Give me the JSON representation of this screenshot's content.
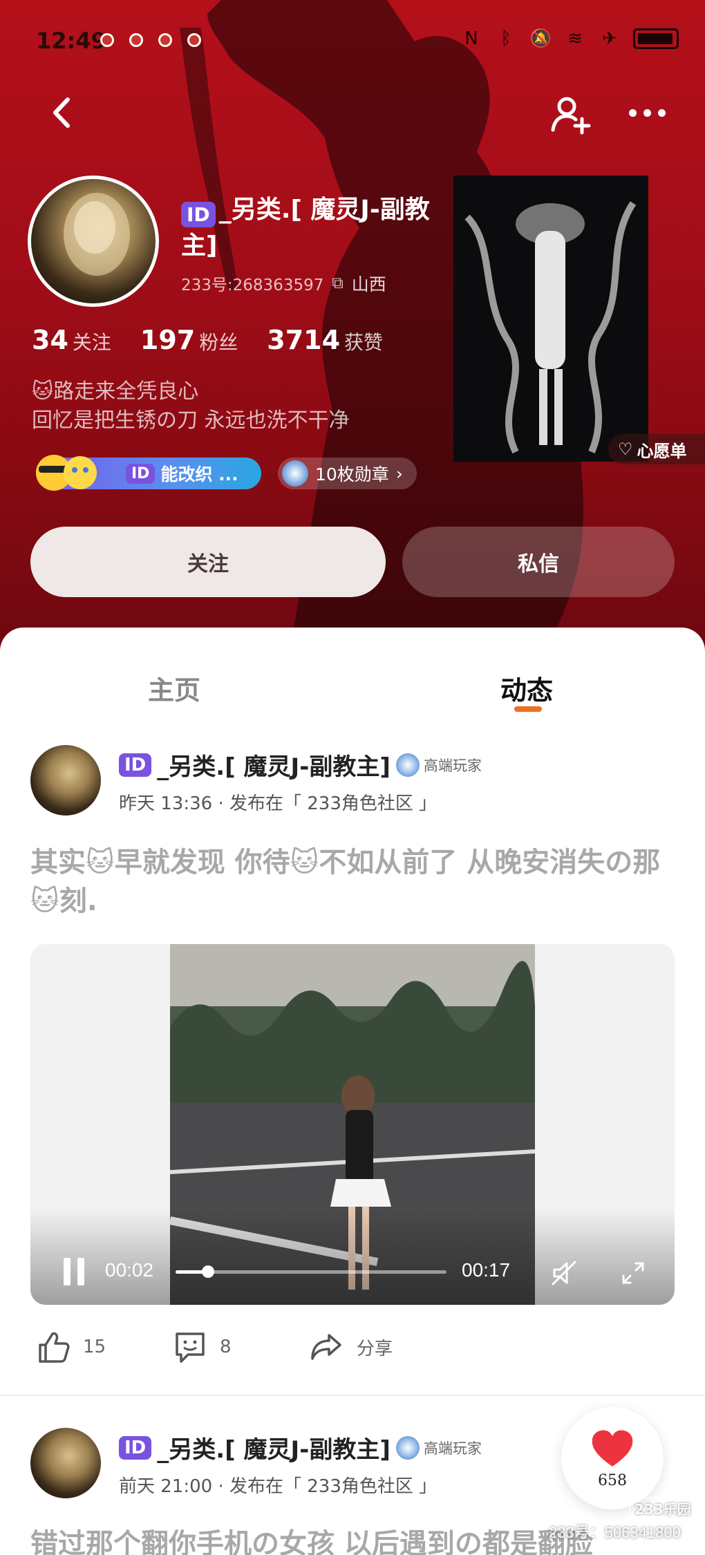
{
  "status_bar": {
    "time": "12:49"
  },
  "profile": {
    "id_badge": "ID",
    "username": "_另类.[ 魔灵J-副教主]",
    "account_line": "233号:268363597",
    "location": "山西",
    "stats": [
      {
        "num": "34",
        "label": "关注"
      },
      {
        "num": "197",
        "label": "粉丝"
      },
      {
        "num": "3714",
        "label": "获赞"
      }
    ],
    "bio_line1": "🐱路走来全凭良心",
    "bio_line2": "回忆是把生锈の刀  永远也洗不干净",
    "title_badge_id": "ID",
    "title_badge_text": "能改织 ...",
    "medal_text": "10枚勋章",
    "wish_label": "心愿单",
    "follow_label": "关注",
    "message_label": "私信"
  },
  "tabs": {
    "home": "主页",
    "feed": "动态"
  },
  "posts": [
    {
      "id_badge": "ID",
      "author": "_另类.[ 魔灵J-副教主]",
      "level": "高端玩家",
      "time_text": "昨天 13:36 · 发布在「 233角色社区 」",
      "text": "其实🐱早就发现 你待🐱不如从前了 从晚安消失の那🐱刻.",
      "video": {
        "current": "00:02",
        "duration": "00:17",
        "progress": 0.12
      },
      "likes": "15",
      "comments": "8",
      "share_label": "分享"
    },
    {
      "id_badge": "ID",
      "author": "_另类.[ 魔灵J-副教主]",
      "level": "高端玩家",
      "time_text": "前天 21:00 · 发布在「 233角色社区 」",
      "text": "错过那个翻你手机の女孩 以后遇到の都是翻脸"
    }
  ],
  "floating_like": {
    "count": "658"
  },
  "watermark": {
    "logo": "233乐园",
    "id": "233号：506341800"
  },
  "colors": {
    "hero": "#b4101a",
    "accent": "#f07020",
    "id_badge": "#7a52e0"
  }
}
